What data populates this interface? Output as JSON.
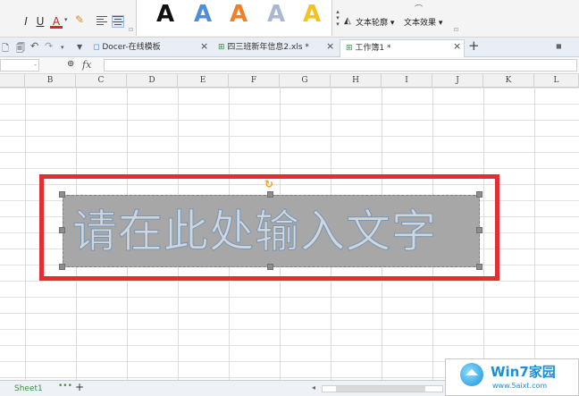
{
  "ribbon": {
    "format_buttons": [
      "I",
      "U",
      "A"
    ],
    "style_letters": [
      {
        "letter": "A",
        "color": "#111111"
      },
      {
        "letter": "A",
        "color": "#4f8ed8"
      },
      {
        "letter": "A",
        "color": "#f07f2a"
      },
      {
        "letter": "A",
        "color": "#aab8d4"
      },
      {
        "letter": "A",
        "color": "#f3c21c"
      }
    ],
    "text_outline_label": "文本轮廓 ▾",
    "text_effect_label": "文本效果 ▾"
  },
  "tabs": [
    {
      "label": "Docer-在线模板",
      "active": false
    },
    {
      "label": "四三班新年信息2.xls *",
      "active": false
    },
    {
      "label": "工作簿1 *",
      "active": true
    }
  ],
  "formula_bar": {
    "fx_label": "fx",
    "name_box": "-"
  },
  "columns": [
    "B",
    "C",
    "D",
    "E",
    "F",
    "G",
    "H",
    "I",
    "J",
    "K",
    "L"
  ],
  "textbox": {
    "text": "请在此处输入文字"
  },
  "sheetbar": {
    "sheet_name": "Sheet1",
    "more": "•••",
    "add": "+"
  },
  "watermark": {
    "title": "Win7家园",
    "url": "www.5aixt.com"
  },
  "colors": {
    "highlight_red": "#e03035",
    "accent_blue": "#1a8ed6",
    "sheet_green": "#3f8f3f"
  }
}
